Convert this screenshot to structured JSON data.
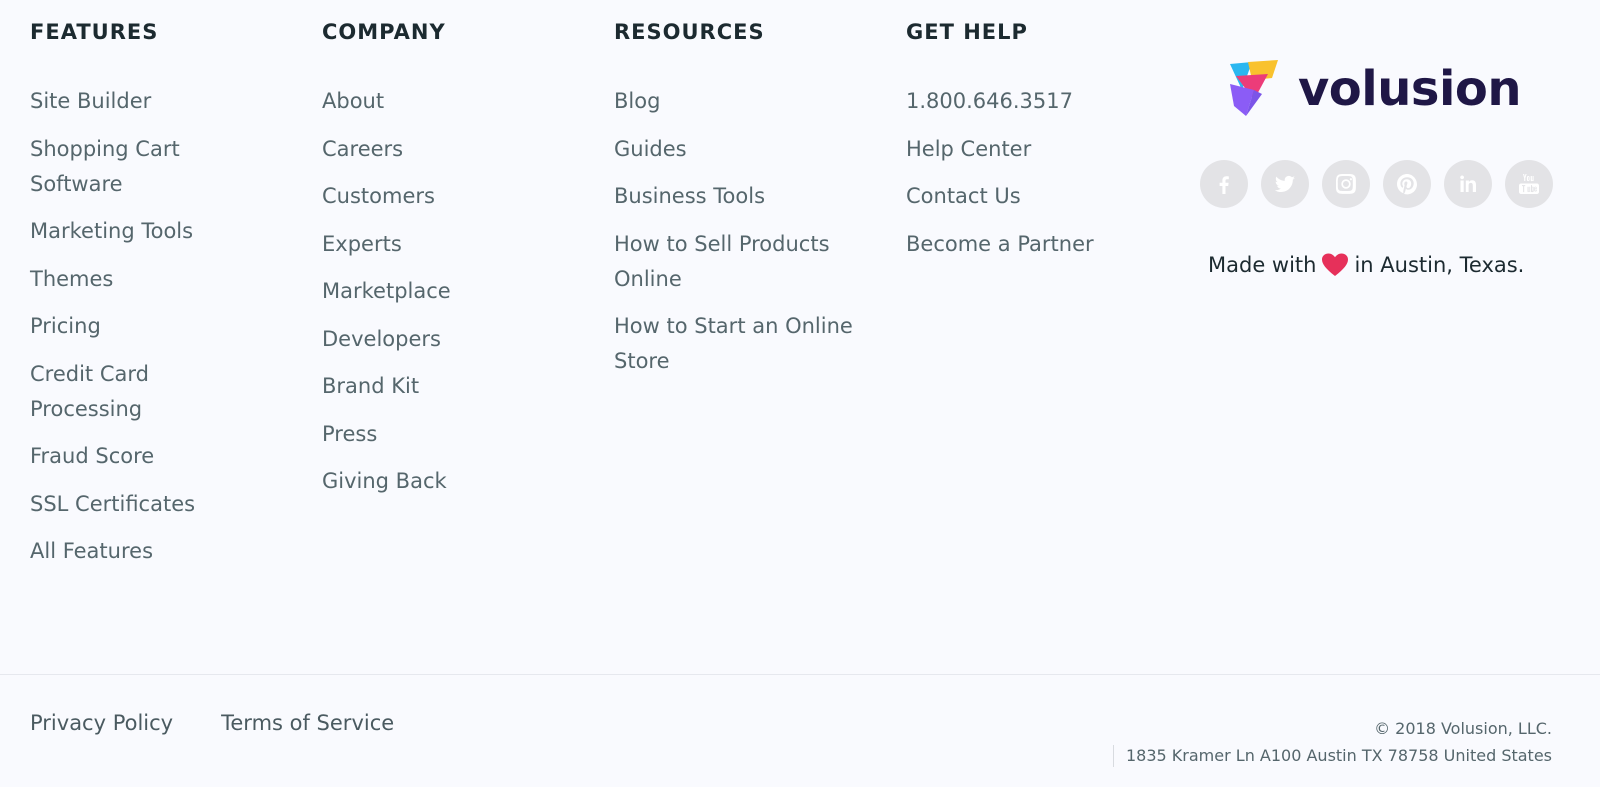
{
  "columns": {
    "features": {
      "heading": "FEATURES",
      "items": [
        "Site Builder",
        "Shopping Cart Software",
        "Marketing Tools",
        "Themes",
        "Pricing",
        "Credit Card Processing",
        "Fraud Score",
        "SSL Certificates",
        "All Features"
      ]
    },
    "company": {
      "heading": "COMPANY",
      "items": [
        "About",
        "Careers",
        "Customers",
        "Experts",
        "Marketplace",
        "Developers",
        "Brand Kit",
        "Press",
        "Giving Back"
      ]
    },
    "resources": {
      "heading": "RESOURCES",
      "items": [
        "Blog",
        "Guides",
        "Business Tools",
        "How to Sell Products Online",
        "How to Start an Online Store"
      ]
    },
    "help": {
      "heading": "GET HELP",
      "items": [
        "1.800.646.3517",
        "Help Center",
        "Contact Us",
        "Become a Partner"
      ]
    }
  },
  "brand": {
    "name": "volusion",
    "social": [
      "facebook-icon",
      "twitter-icon",
      "instagram-icon",
      "pinterest-icon",
      "linkedin-icon",
      "youtube-icon"
    ],
    "made_before": "Made with",
    "made_after": "in Austin, Texas.",
    "heart_color": "#e6305a"
  },
  "footer": {
    "privacy": "Privacy Policy",
    "terms": "Terms of Service",
    "copyright": "© 2018 Volusion, LLC.",
    "address": "1835 Kramer Ln A100 Austin TX 78758 United States"
  },
  "colors": {
    "background": "#f9fafe",
    "heading": "#1c2a30",
    "link": "#55666c",
    "brand_text": "#1f1746",
    "social_circle": "#e3e3e6"
  }
}
